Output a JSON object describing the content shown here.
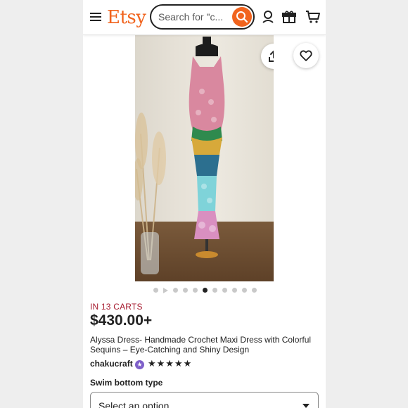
{
  "header": {
    "logo": "Etsy",
    "search_placeholder": "Search for \"c...",
    "icons": [
      "menu-icon",
      "search-icon",
      "account-icon",
      "gift-icon",
      "cart-icon"
    ]
  },
  "gallery": {
    "dot_count": 11,
    "active_index": 5,
    "icons": [
      "share-icon",
      "heart-icon",
      "play-icon"
    ]
  },
  "listing": {
    "carts": "IN 13 CARTS",
    "price": "$430.00+",
    "title": "Alyssa Dress- Handmade Crochet Maxi Dress with Colorful Sequins – Eye-Catching and Shiny Design",
    "shop": "chakucraft",
    "stars": "★★★★★",
    "option_label": "Swim bottom type",
    "select_value": "Select an option"
  },
  "colors": {
    "brand": "#f1641e",
    "carts": "#a61a2e",
    "star_seller": "#7e5fc9"
  }
}
